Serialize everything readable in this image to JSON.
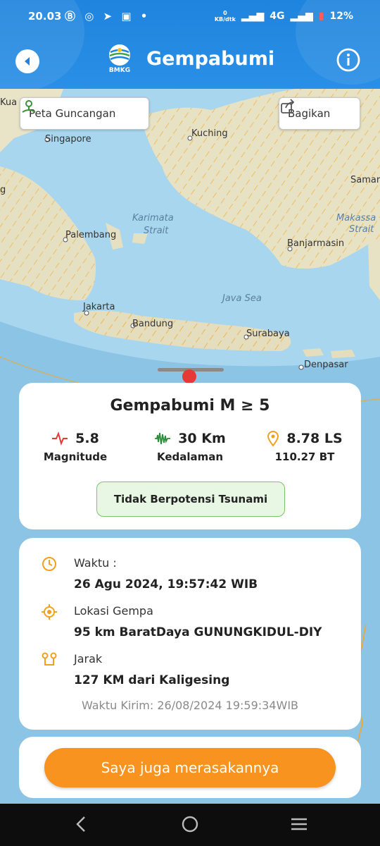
{
  "status_bar": {
    "time": "20.03",
    "speed_value": "0",
    "speed_unit": "KB/dtk",
    "network": "4G",
    "battery": "12%"
  },
  "header": {
    "title": "Gempabumi",
    "logo_text": "BMKG",
    "colors": {
      "header_bg": "#1f84dd",
      "accent": "#f7931e"
    }
  },
  "map": {
    "buttons": {
      "shake_map": "Peta Guncangan",
      "share": "Bagikan"
    },
    "labels": {
      "kuala": "Kua",
      "singapore": "Singapore",
      "kuching": "Kuching",
      "samarinda": "Samar",
      "palembang": "Palembang",
      "banjarmasin": "Banjarmasin",
      "jakarta": "Jakarta",
      "bandung": "Bandung",
      "surabaya": "Surabaya",
      "denpasar": "Denpasar",
      "edge_g": "g"
    },
    "sea_labels": {
      "karimata1": "Karimata",
      "karimata2": "Strait",
      "java_sea": "Java Sea",
      "makassar1": "Makassa",
      "makassar2": "Strait"
    }
  },
  "quake": {
    "heading": "Gempabumi M ≥ 5",
    "magnitude": {
      "value": "5.8",
      "label": "Magnitude"
    },
    "depth": {
      "value": "30 Km",
      "label": "Kedalaman"
    },
    "location": {
      "lat": "8.78 LS",
      "lon": "110.27 BT"
    },
    "tsunami": "Tidak Berpotensi Tsunami"
  },
  "details": {
    "time_label": "Waktu :",
    "time_value": "26 Agu 2024, 19:57:42 WIB",
    "place_label": "Lokasi Gempa",
    "place_value": "95 km BaratDaya GUNUNGKIDUL-DIY",
    "distance_label": "Jarak",
    "distance_value": "127 KM dari Kaligesing",
    "sent": "Waktu Kirim: 26/08/2024 19:59:34WIB"
  },
  "action": {
    "felt_button": "Saya juga merasakannya"
  }
}
